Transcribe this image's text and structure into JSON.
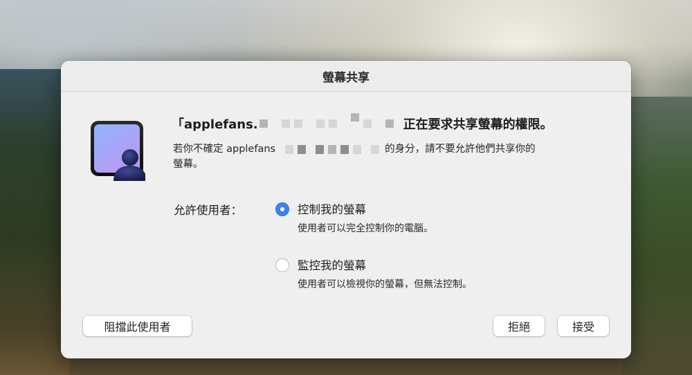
{
  "dialog": {
    "title": "螢幕共享",
    "headline": {
      "prefix": "「applefans.",
      "suffix": "正在要求共享螢幕的權限。"
    },
    "message": {
      "prefix": "若你不確定 applefans",
      "suffix": "的身分，請不要允許他們共享你的",
      "line2": "螢幕。"
    },
    "allow_label": "允許使用者：",
    "options": [
      {
        "title": "控制我的螢幕",
        "description": "使用者可以完全控制你的電腦。",
        "selected": true
      },
      {
        "title": "監控我的螢幕",
        "description": "使用者可以檢視你的螢幕，但無法控制。",
        "selected": false
      }
    ],
    "buttons": {
      "block": "阻擋此使用者",
      "decline": "拒絕",
      "accept": "接受"
    }
  },
  "colors": {
    "accent": "#3b82f0",
    "dialog_bg": "#efefef",
    "icon_gradient_top": "#8fb0ff",
    "icon_gradient_bottom": "#b79af0"
  },
  "icons": {
    "app": "screen-sharing-icon",
    "radio_selected": "radio-selected-icon",
    "radio_unselected": "radio-unselected-icon"
  }
}
